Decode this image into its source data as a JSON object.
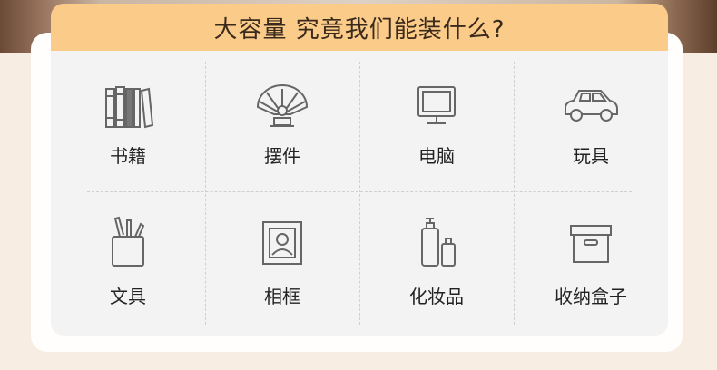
{
  "banner": {
    "title": "大容量 究竟我们能装什么?"
  },
  "items": [
    {
      "label": "书籍",
      "icon": "books-icon"
    },
    {
      "label": "摆件",
      "icon": "fan-ornament-icon"
    },
    {
      "label": "电脑",
      "icon": "monitor-icon"
    },
    {
      "label": "玩具",
      "icon": "toy-car-icon"
    },
    {
      "label": "文具",
      "icon": "pen-holder-icon"
    },
    {
      "label": "相框",
      "icon": "photo-frame-icon"
    },
    {
      "label": "化妆品",
      "icon": "cosmetics-bottles-icon"
    },
    {
      "label": "收纳盒子",
      "icon": "storage-box-icon"
    }
  ],
  "colors": {
    "banner": "#fbcb8a",
    "panel": "#f3f3f3",
    "page": "#f8ede2"
  }
}
